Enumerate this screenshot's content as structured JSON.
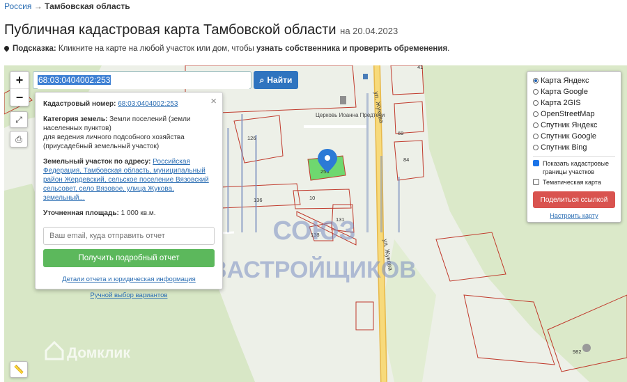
{
  "breadcrumb": {
    "root": "Россия",
    "arrow": "→",
    "current": "Тамбовская область"
  },
  "page": {
    "title": "Публичная кадастровая карта Тамбовской области",
    "date": "на 20.04.2023"
  },
  "hint": {
    "label": "Подсказка:",
    "text": "Кликните на карте на любой участок или дом, чтобы",
    "strong": "узнать собственника и проверить обременения",
    "end": "."
  },
  "search": {
    "value": "68:03:0404002:253",
    "button": "Найти"
  },
  "zoom": {
    "plus": "+",
    "minus": "−"
  },
  "popup": {
    "cad_label": "Кадастровый номер:",
    "cad_value": "68:03:0404002:253",
    "cat_label": "Категория земель:",
    "cat_value": "Земли поселений (земли населенных пунктов)",
    "use_value": "для ведения личного подсобного хозяйства (приусадебный земельный участок)",
    "addr_label": "Земельный участок по адресу:",
    "addr_value": "Российская Федерация, Тамбовская область, муниципальный район Жердевский, сельское поселение Вязовский сельсовет, село Вязовое, улица Жукова, земельный...",
    "area_label": "Уточненная площадь:",
    "area_value": "1 000 кв.м.",
    "email_placeholder": "Ваш email, куда отправить отчет",
    "report_button": "Получить подробный отчет",
    "details_link": "Детали отчета и юридическая информация",
    "manual_link": "Ручной выбор вариантов"
  },
  "layers": {
    "options": [
      "Карта Яндекс",
      "Карта Google",
      "Карта 2GIS",
      "OpenStreetMap",
      "Спутник Яндекс",
      "Спутник Google",
      "Спутник Bing"
    ],
    "selected": "Карта Яндекс",
    "show_borders": "Показать кадастровые границы участков",
    "thematic": "Тематическая карта",
    "share_button": "Поделиться ссылкой",
    "link_settings": "Настроить карту"
  },
  "map_labels": {
    "church": "Церковь Иоанна Предтечи",
    "street": "ул. Жукова",
    "parcels": [
      "41",
      "126",
      "84",
      "69",
      "136",
      "10",
      "131",
      "138",
      "253",
      "982"
    ],
    "watermark_top": "СОЮЗ",
    "watermark_bottom": "ЗАСТРОЙЩИКОВ",
    "domclick": "Домклик"
  },
  "colors": {
    "parcel_border": "#c0392b",
    "selected_parcel": "#6fd86f",
    "road": "#f4c542",
    "map_green": "#dbe8c8",
    "marker": "#2c7ad6"
  }
}
